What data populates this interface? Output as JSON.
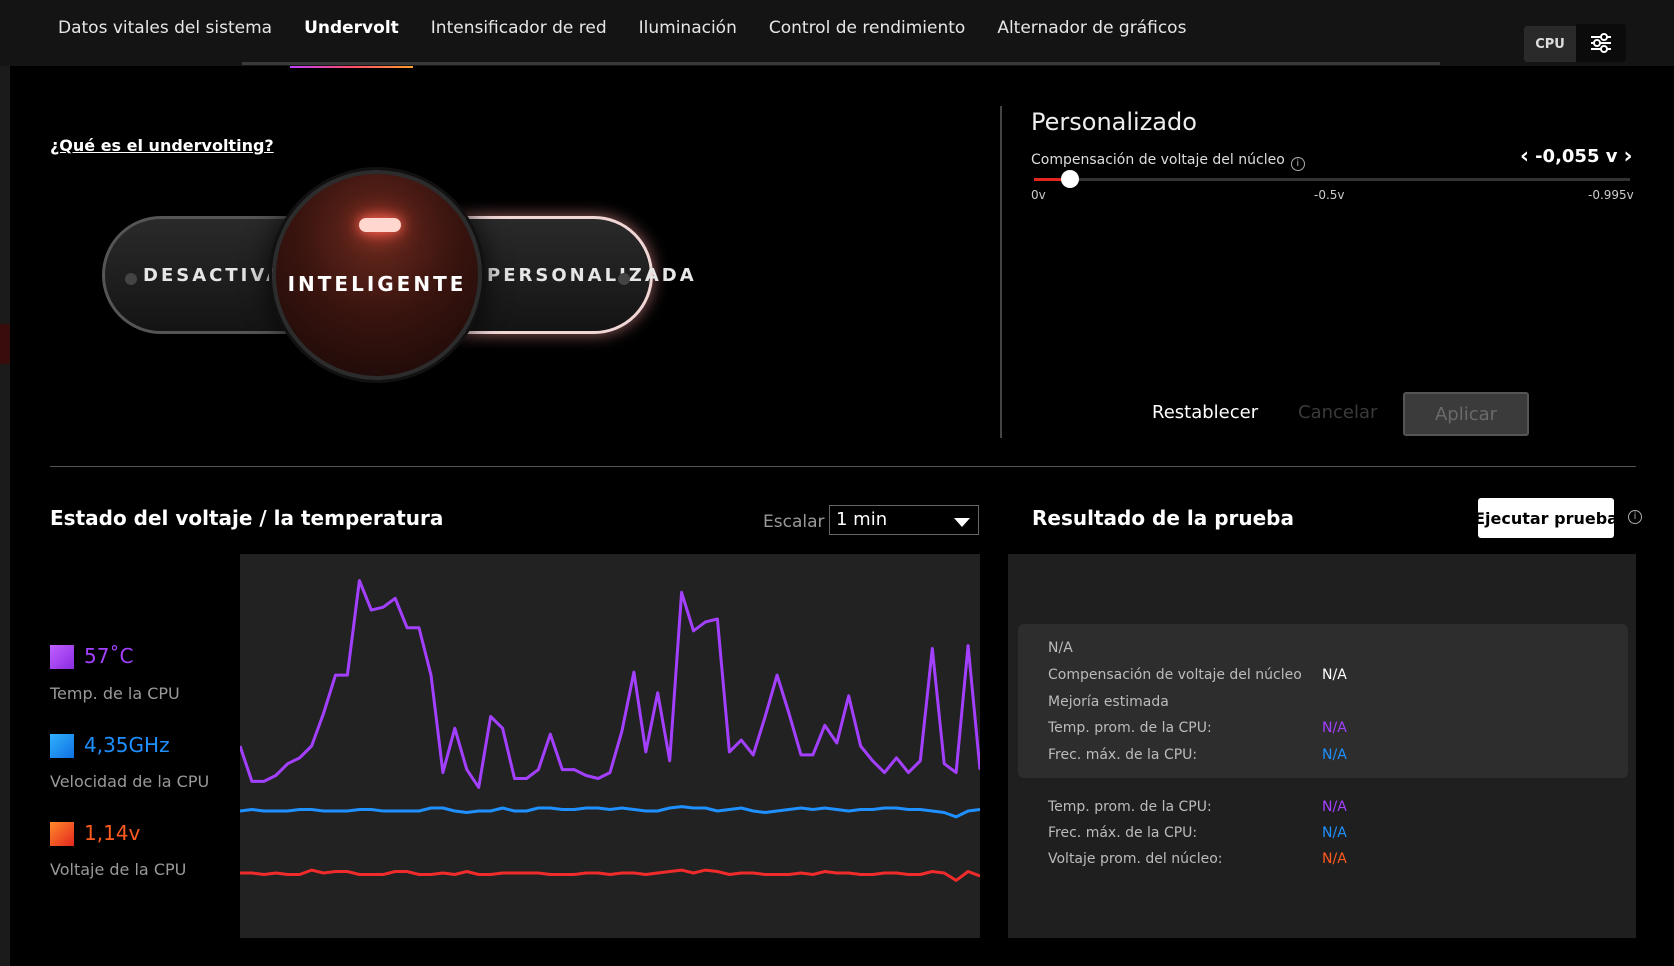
{
  "tabs": [
    {
      "label": "Datos vitales del sistema"
    },
    {
      "label": "Undervolt"
    },
    {
      "label": "Intensificador de red"
    },
    {
      "label": "Iluminación"
    },
    {
      "label": "Control de rendimiento"
    },
    {
      "label": "Alternador de gráficos"
    }
  ],
  "active_tab": "Undervolt",
  "header": {
    "cpu_label": "CPU"
  },
  "help_link": "¿Qué es el undervolting?",
  "mode_switch": {
    "off_label": "DESACTIVADO",
    "smart_label": "INTELIGENTE",
    "custom_label": "PERSONALIZADA",
    "selected": "INTELIGENTE"
  },
  "custom": {
    "title": "Personalizado",
    "offset_label": "Compensación de voltaje del núcleo",
    "offset_value": "-0,055 v",
    "offset_numeric": -0.055,
    "slider_min": 0,
    "slider_max": -0.995,
    "tick_labels": [
      "0v",
      "-0.5v",
      "-0.995v"
    ],
    "reset_label": "Restablecer",
    "cancel_label": "Cancelar",
    "apply_label": "Aplicar"
  },
  "status": {
    "title": "Estado del voltaje / la temperatura",
    "scale_label": "Escalar",
    "scale_value": "1 min",
    "metrics": [
      {
        "value": "57˚C",
        "label": "Temp. de la CPU",
        "color": "#a340ff"
      },
      {
        "value": "4,35GHz",
        "label": "Velocidad de la CPU",
        "color": "#1e90ff"
      },
      {
        "value": "1,14v",
        "label": "Voltaje de la CPU",
        "color": "#ff5a1f"
      }
    ]
  },
  "chart_data": {
    "type": "line",
    "x": [
      0,
      1,
      2,
      3,
      4,
      5,
      6,
      7,
      8,
      9,
      10,
      11,
      12,
      13,
      14,
      15,
      16,
      17,
      18,
      19,
      20,
      21,
      22,
      23,
      24,
      25,
      26,
      27,
      28,
      29,
      30,
      31,
      32,
      33,
      34,
      35,
      36,
      37,
      38,
      39,
      40,
      41,
      42,
      43,
      44,
      45,
      46,
      47,
      48,
      49,
      50,
      51,
      52,
      53,
      54,
      55,
      56,
      57,
      58,
      59,
      60,
      61,
      62
    ],
    "series": [
      {
        "color": "#a340ff",
        "values": [
          65,
          53,
          53,
          55,
          59,
          61,
          65,
          76,
          89,
          89,
          121,
          111,
          112,
          115,
          105,
          105,
          89,
          56,
          71,
          57,
          51,
          75,
          71,
          54,
          54,
          57,
          69,
          57,
          57,
          55,
          54,
          56,
          70,
          90,
          63,
          83,
          60,
          117,
          104,
          107,
          108,
          63,
          67,
          62,
          75,
          89,
          76,
          62,
          62,
          72,
          66,
          82,
          65,
          60,
          56,
          61,
          56,
          60,
          98,
          59,
          56,
          99,
          57
        ]
      },
      {
        "color": "#1e90ff",
        "values": [
          43,
          43.5,
          43,
          43,
          43,
          43.5,
          43.5,
          43,
          43,
          43,
          43.5,
          43.5,
          43,
          43,
          43,
          43,
          44,
          44,
          43,
          42.5,
          43,
          43,
          44,
          43,
          43,
          44,
          44,
          43.5,
          43.5,
          44,
          44,
          43.5,
          44,
          43.5,
          43,
          43,
          44,
          44.5,
          44,
          44,
          43,
          43.5,
          44,
          43,
          42.5,
          43,
          43.5,
          44,
          43.5,
          44,
          43.5,
          43,
          43.5,
          43.5,
          44,
          44,
          43.5,
          43.5,
          43,
          42.5,
          41,
          43,
          43.5
        ]
      },
      {
        "color": "#ef2b2b",
        "values": [
          22,
          22,
          21.5,
          22,
          21.5,
          21.5,
          23,
          22,
          22.5,
          22.5,
          21.5,
          21.5,
          21.5,
          22.5,
          22.5,
          21.5,
          21.5,
          22,
          21.5,
          22.5,
          21.5,
          21.5,
          22,
          22,
          22,
          22,
          21.5,
          21.5,
          21.5,
          22,
          22,
          21.5,
          22,
          22,
          21.5,
          22,
          22.5,
          23,
          22,
          23,
          22.5,
          21.5,
          22,
          22,
          21.5,
          21.5,
          21.5,
          22,
          21.5,
          22.5,
          22,
          22,
          21.5,
          21.5,
          22,
          22,
          21.5,
          21.5,
          22.5,
          22,
          19.5,
          22.5,
          21
        ]
      }
    ],
    "ylim": [
      0,
      130
    ],
    "grid": false,
    "legend": "left"
  },
  "results": {
    "title": "Resultado de la prueba",
    "run_label": "Ejecutar prueba",
    "na_header": "N/A",
    "offset_label": "Compensación de voltaje del núcleo",
    "offset_value": "N/A",
    "improvement_label": "Mejoría estimada",
    "avg_temp_label": "Temp. prom. de la CPU:",
    "avg_temp_value": "N/A",
    "max_freq_label": "Frec. máx. de la CPU:",
    "max_freq_value": "N/A",
    "avg_temp_label2": "Temp. prom. de la CPU:",
    "avg_temp_value2": "N/A",
    "max_freq_label2": "Frec. máx. de la CPU:",
    "max_freq_value2": "N/A",
    "avg_volt_label": "Voltaje prom. del núcleo:",
    "avg_volt_value": "N/A",
    "colors": {
      "temp": "#a340ff",
      "freq": "#1e90ff",
      "volt": "#ff5a1f"
    }
  }
}
